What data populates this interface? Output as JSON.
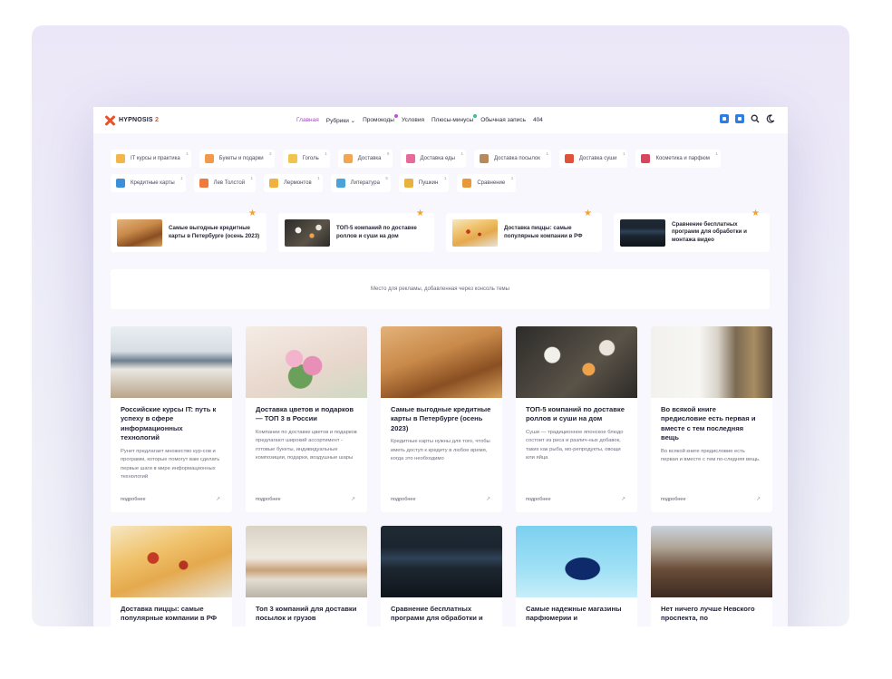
{
  "site": {
    "logo_name": "HYPNOSIS",
    "logo_version": "2"
  },
  "nav": {
    "items": [
      {
        "label": "Главная",
        "active": true
      },
      {
        "label": "Рубрики ⌄",
        "active": false
      },
      {
        "label": "Промокоды",
        "active": false,
        "dot": "#c24dde"
      },
      {
        "label": "Условия",
        "active": false
      },
      {
        "label": "Плюсы-минусы",
        "active": false,
        "dot": "#37c28b"
      },
      {
        "label": "Обычная запись",
        "active": false
      },
      {
        "label": "404",
        "active": false
      }
    ]
  },
  "header_icons": [
    "vk-icon",
    "telegram-icon",
    "search-icon",
    "moon-icon"
  ],
  "categories": [
    {
      "label": "IT курсы и практика",
      "count": "1",
      "color": "#f2b64a"
    },
    {
      "label": "Букеты и подарки",
      "count": "2",
      "color": "#f29a4a"
    },
    {
      "label": "Гоголь",
      "count": "1",
      "color": "#f1c54c"
    },
    {
      "label": "Доставка",
      "count": "6",
      "color": "#f3a552"
    },
    {
      "label": "Доставка еды",
      "count": "1",
      "color": "#e86a9a"
    },
    {
      "label": "Доставка посылок",
      "count": "1",
      "color": "#b8895b"
    },
    {
      "label": "Доставка суши",
      "count": "1",
      "color": "#e1523b"
    },
    {
      "label": "Косметика и парфюм",
      "count": "1",
      "color": "#d9445e"
    },
    {
      "label": "Кредитные карты",
      "count": "1",
      "color": "#3c8fd8"
    },
    {
      "label": "Лев Толстой",
      "count": "1",
      "color": "#ef7a3b"
    },
    {
      "label": "Лермонтов",
      "count": "1",
      "color": "#f0b23f"
    },
    {
      "label": "Литература",
      "count": "5",
      "color": "#4aa3d9"
    },
    {
      "label": "Пушкин",
      "count": "1",
      "color": "#e9b13d"
    },
    {
      "label": "Сравнение",
      "count": "1",
      "color": "#e8983a"
    }
  ],
  "featured": [
    {
      "title": "Самые выгодные кредитные карты в Петербурге (осень 2023)",
      "image": "wallet"
    },
    {
      "title": "ТОП-5 компаний по доставке роллов и суши на дом",
      "image": "sushi"
    },
    {
      "title": "Доставка пиццы: самые популярные компании в РФ",
      "image": "pizza"
    },
    {
      "title": "Сравнение бесплатных программ для обработки и монтажа видео",
      "image": "editing"
    }
  ],
  "ad_text": "Место для рекламы, добавленная через консоль темы",
  "more_label": "подробнее",
  "posts": [
    {
      "title": "Российские курсы IT: путь к успеху в сфере информационных технологий",
      "excerpt": "Рунет предлагает множество кур-сов и программ, которые помогут вам сделать первые шаги в мире информационных технологий",
      "image": "desk"
    },
    {
      "title": "Доставка цветов и подарков — ТОП 3 в России",
      "excerpt": "Компании по доставке цветов и подарков предлагают широкий ассортимент - готовые букеты, индивидуальные композиции, подарки, воздушные шары",
      "image": "flowers"
    },
    {
      "title": "Самые выгодные кредитные карты в Петербурге (осень 2023)",
      "excerpt": "Кредитные карты нужны для того, чтобы иметь доступ к кредиту в любое время, когда это необходимо",
      "image": "wallet"
    },
    {
      "title": "ТОП-5 компаний по доставке роллов и суши на дом",
      "excerpt": "Суши — традиционное японское блюдо состоит из риса и различ-ных добавок, таких как рыба, мо-репродукты, овощи или яйца",
      "image": "sushi"
    },
    {
      "title": "Во всякой книге предисловие есть первая и вместе с тем последняя вещь",
      "excerpt": "Во всякой книге предисловие есть первая и вместе с тем по-следняя вещь.",
      "image": "library"
    },
    {
      "title": "Доставка пиццы: самые популярные компании в РФ",
      "excerpt": "",
      "image": "pizza"
    },
    {
      "title": "Топ 3 компаний для доставки посылок и грузов",
      "excerpt": "",
      "image": "parcel"
    },
    {
      "title": "Сравнение бесплатных программ для обработки и",
      "excerpt": "",
      "image": "editing"
    },
    {
      "title": "Самые надежные магазины парфюмерии и",
      "excerpt": "",
      "image": "perfume"
    },
    {
      "title": "Нет ничего лучше Невского проспекта, по",
      "excerpt": "",
      "image": "street"
    }
  ]
}
